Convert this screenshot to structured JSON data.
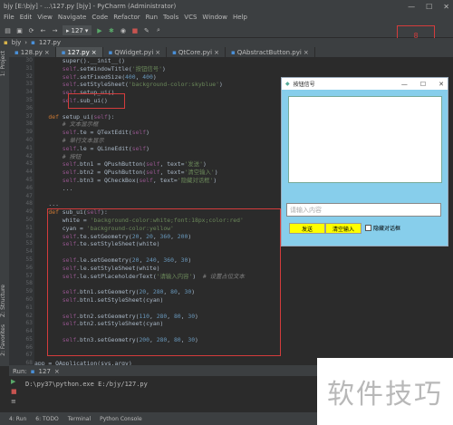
{
  "window_title": "bjy [E:\\bjy] - ...\\127.py [bjy] - PyCharm (Administrator)",
  "menu": [
    "File",
    "Edit",
    "View",
    "Navigate",
    "Code",
    "Refactor",
    "Run",
    "Tools",
    "VCS",
    "Window",
    "Help"
  ],
  "toolbar": {
    "run_config": "127"
  },
  "breadcrumb": [
    "bjy",
    "127.py"
  ],
  "tabs": [
    {
      "label": "128.py",
      "active": false
    },
    {
      "label": "127.py",
      "active": true
    },
    {
      "label": "QWidget.pyi",
      "active": false
    },
    {
      "label": "QtCore.pyi",
      "active": false
    },
    {
      "label": "QAbstractButton.pyi",
      "active": false
    }
  ],
  "sidebar": {
    "top": "1: Project",
    "structure": "Z: Structure",
    "favorites": "2: Favorites"
  },
  "line_numbers": [
    "30",
    "31",
    "32",
    "33",
    "34",
    "35",
    "36",
    "37",
    "38",
    "39",
    "40",
    "41",
    "42",
    "43",
    "44",
    "45",
    "46",
    "47",
    "48",
    "49",
    "50",
    "51",
    "52",
    "53",
    "54",
    "55",
    "56",
    "57",
    "58",
    "59",
    "60",
    "61",
    "62",
    "63",
    "64",
    "65",
    "66",
    "67",
    "68"
  ],
  "code_lines": [
    "        super().__init__()",
    "        self.setWindowTitle('按钮信号')",
    "        self.setFixedSize(400, 400)",
    "        self.setStyleSheet('background-color:skyblue')",
    "        self.setup_ui()",
    "        self.sub_ui()",
    "",
    "    def setup_ui(self):",
    "        # 文本显示框",
    "        self.te = QTextEdit(self)",
    "        # 单行文本显示",
    "        self.le = QLineEdit(self)",
    "        # 按钮",
    "        self.btn1 = QPushButton(self, text='发送')",
    "        self.btn2 = QPushButton(self, text='清空输入')",
    "        self.btn3 = QCheckBox(self, text='隐藏对话框')",
    "        ...",
    "",
    "    ...",
    "    def sub_ui(self):",
    "        white = 'background-color:white;font:18px;color:red'",
    "        cyan = 'background-color:yellow'",
    "        self.te.setGeometry(20, 20, 360, 200)",
    "        self.te.setStyleSheet(white)",
    "",
    "        self.le.setGeometry(20, 240, 360, 30)",
    "        self.le.setStyleSheet(white)",
    "        self.le.setPlaceholderText('请输入内容')  # 设置占位文本",
    "",
    "        self.btn1.setGeometry(20, 280, 80, 30)",
    "        self.btn1.setStyleSheet(cyan)",
    "",
    "        self.btn2.setGeometry(110, 280, 80, 30)",
    "        self.btn2.setStyleSheet(cyan)",
    "",
    "        self.btn3.setGeometry(200, 280, 80, 30)",
    "",
    "",
    "app = QApplication(sys.argv)"
  ],
  "run_panel": {
    "tab": "Run:",
    "config": "127",
    "output": "D:\\py37\\python.exe E:/bjy/127.py"
  },
  "bottom_tabs": [
    "4: Run",
    "6: TODO",
    "Terminal",
    "Python Console"
  ],
  "qt_window": {
    "title": "按钮信号",
    "placeholder": "请输入内容",
    "btn_send": "发送",
    "btn_clear": "清空输入",
    "checkbox": "隐藏对话框"
  },
  "watermark": "软件技巧",
  "annotation_label": "8"
}
